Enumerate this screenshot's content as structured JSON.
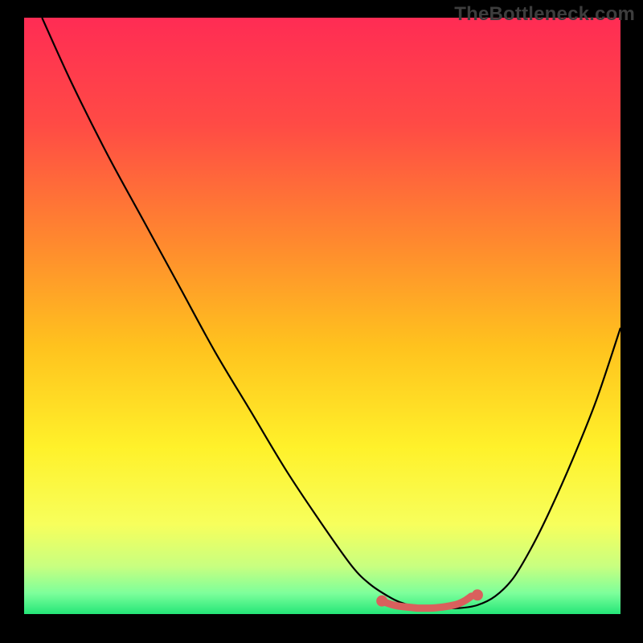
{
  "watermark": "TheBottleneck.com",
  "chart_data": {
    "type": "line",
    "title": "",
    "xlabel": "",
    "ylabel": "",
    "xlim": [
      0,
      100
    ],
    "ylim": [
      0,
      100
    ],
    "grid": false,
    "legend": false,
    "background_gradient": {
      "stops": [
        {
          "offset": 0.0,
          "color": "#ff2c54"
        },
        {
          "offset": 0.18,
          "color": "#ff4b45"
        },
        {
          "offset": 0.38,
          "color": "#ff8a2e"
        },
        {
          "offset": 0.55,
          "color": "#ffc21e"
        },
        {
          "offset": 0.72,
          "color": "#fff12a"
        },
        {
          "offset": 0.85,
          "color": "#f7ff5c"
        },
        {
          "offset": 0.92,
          "color": "#c8ff80"
        },
        {
          "offset": 0.965,
          "color": "#7dff9b"
        },
        {
          "offset": 1.0,
          "color": "#24e678"
        }
      ]
    },
    "series": [
      {
        "name": "main-curve",
        "color": "#000000",
        "x": [
          3,
          8,
          14,
          20,
          26,
          32,
          38,
          44,
          50,
          55,
          58,
          61,
          63,
          66,
          70,
          73,
          76,
          79,
          82,
          85,
          88,
          92,
          96,
          100
        ],
        "y": [
          100,
          89,
          77,
          66,
          55,
          44,
          34,
          24,
          15,
          8,
          5,
          3,
          2,
          1.2,
          1,
          1,
          1.5,
          3,
          6,
          11,
          17,
          26,
          36,
          48
        ]
      },
      {
        "name": "optimal-band-marker",
        "color": "#d9605d",
        "x": [
          60,
          61,
          62,
          63,
          64,
          65,
          66,
          67,
          68,
          69,
          70,
          71,
          72,
          73,
          74,
          75
        ],
        "y": [
          2.2,
          1.8,
          1.5,
          1.3,
          1.2,
          1.1,
          1.0,
          1.0,
          1.0,
          1.05,
          1.15,
          1.3,
          1.5,
          1.8,
          2.3,
          3.0
        ]
      }
    ],
    "annotations": [
      {
        "name": "band-start-dot",
        "x": 60,
        "y": 2.2,
        "color": "#d9605d"
      },
      {
        "name": "band-end-dot",
        "x": 76,
        "y": 3.2,
        "color": "#d9605d"
      }
    ]
  }
}
